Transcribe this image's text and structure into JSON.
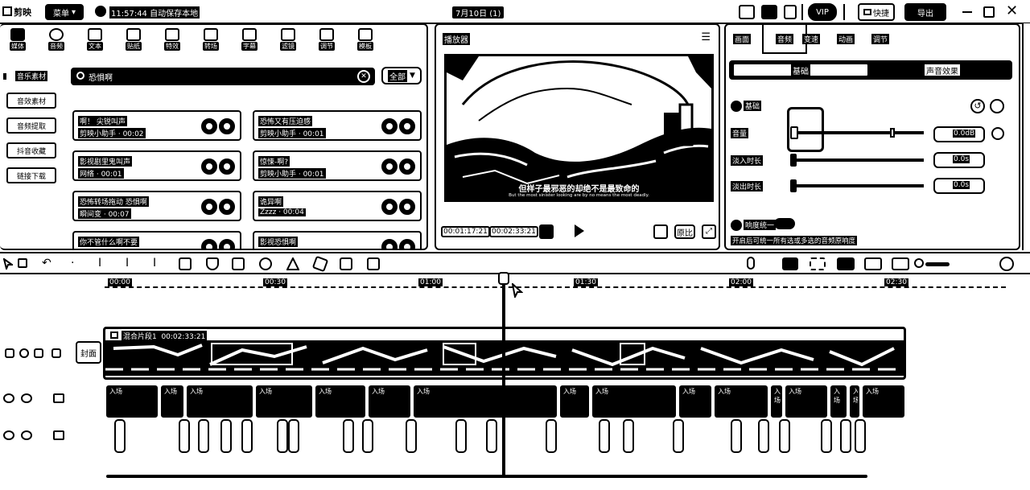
{
  "titlebar": {
    "app_title": "剪映",
    "menu": "菜单",
    "autosave": "11:57:44 自动保存本地",
    "project_name": "7月10日 (1)",
    "vip": "VIP",
    "shortcut": "快捷",
    "export": "导出"
  },
  "tools": [
    {
      "label": "媒体",
      "icon": "media-icon"
    },
    {
      "label": "音频",
      "icon": "audio-icon"
    },
    {
      "label": "文本",
      "icon": "text-icon"
    },
    {
      "label": "贴纸",
      "icon": "sticker-icon"
    },
    {
      "label": "特效",
      "icon": "effects-icon"
    },
    {
      "label": "转场",
      "icon": "transition-icon"
    },
    {
      "label": "字幕",
      "icon": "caption-icon"
    },
    {
      "label": "滤镜",
      "icon": "filter-icon"
    },
    {
      "label": "调节",
      "icon": "adjust-icon"
    },
    {
      "label": "模板",
      "icon": "template-icon"
    }
  ],
  "sidebar": [
    "音乐素材",
    "音效素材",
    "音频提取",
    "抖音收藏",
    "链接下载"
  ],
  "search": {
    "value": "恐惧啊",
    "filter": "全部"
  },
  "results": [
    {
      "title": "啊！ 尖锐叫声",
      "meta": "剪映小助手 · 00:02"
    },
    {
      "title": "恐怖又有压迫感",
      "meta": "剪映小助手 · 00:01"
    },
    {
      "title": "影视剧里鬼叫声",
      "meta": "网络 · 00:01"
    },
    {
      "title": "惊悚-啊?",
      "meta": "剪映小助手 · 00:01"
    },
    {
      "title": "恐怖转场拖动 恐惧啊",
      "meta": "瞬间变 · 00:07"
    },
    {
      "title": "诡异啊",
      "meta": "Zzzz · 00:04"
    },
    {
      "title": "你不管什么啊不要",
      "meta": ""
    },
    {
      "title": "影视恐惧啊",
      "meta": ""
    }
  ],
  "player": {
    "title": "播放器",
    "subtitle_cn": "但样子最邪恶的却绝不是最致命的",
    "subtitle_en": "But the most sinister looking are by no means the most deadly.",
    "time_current": "00:01:17:21",
    "time_total": "00:02:33:21",
    "ratio": "原比"
  },
  "inspector": {
    "tabs": [
      "画面",
      "音频",
      "变速",
      "动画",
      "调节"
    ],
    "active_tab": "音频",
    "subtabs": [
      "基础",
      "声音效果"
    ],
    "section_basic": "基础",
    "volume_label": "音量",
    "volume_value": "0.0dB",
    "fade_in_label": "淡入时长",
    "fade_in_value": "0.0s",
    "fade_out_label": "淡出时长",
    "fade_out_value": "0.0s",
    "normalize_label": "响度统一",
    "normalize_desc": "开启后可统一所有选或多选的音频原响度"
  },
  "timeline": {
    "ticks": [
      "00:00",
      "00:30",
      "01:00",
      "01:30",
      "02:00",
      "02:30"
    ],
    "cover_label": "封面",
    "main_clip_label": "混合片段1  00:02:33:21",
    "keyframe_label": "入场",
    "playhead_percent": 49.3
  }
}
